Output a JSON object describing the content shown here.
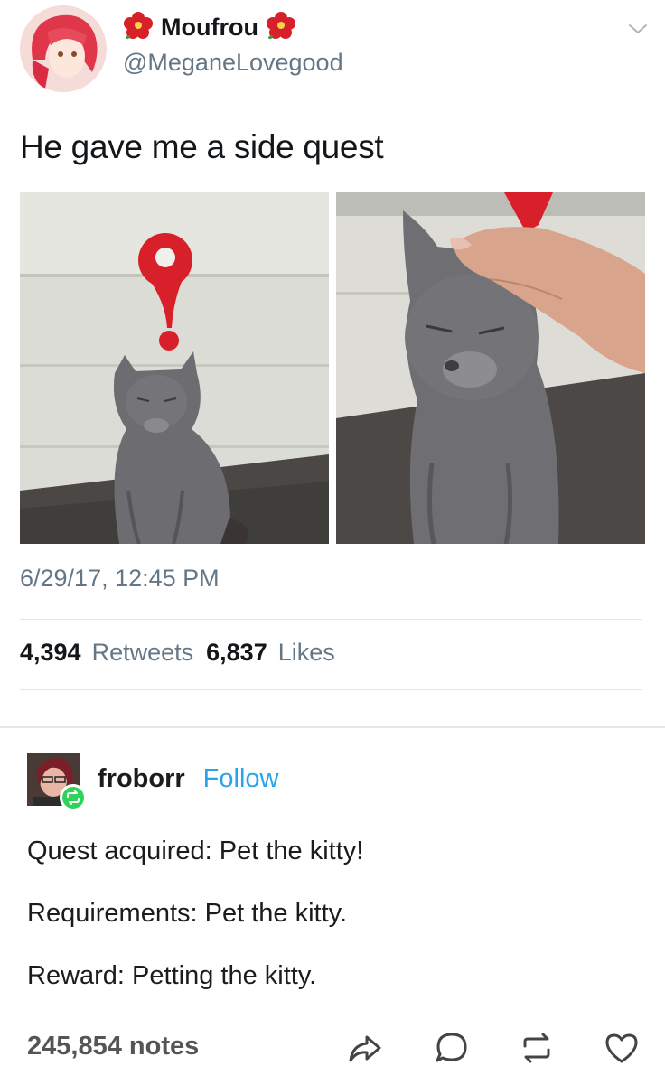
{
  "tweet": {
    "display_name": "Moufrou",
    "handle": "@MeganeLovegood",
    "text": "He gave me a side quest",
    "timestamp": "6/29/17, 12:45 PM",
    "retweets_count": "4,394",
    "retweets_label": "Retweets",
    "likes_count": "6,837",
    "likes_label": "Likes",
    "name_emoji_icon": "hibiscus-flower-icon",
    "menu_icon": "chevron-down-icon",
    "photos": [
      "photo of grey cat sitting under red exclamation mark",
      "photo of grey cat being petted"
    ]
  },
  "reblog": {
    "blog_name": "froborr",
    "follow_label": "Follow",
    "lines": [
      "Quest acquired: Pet the kitty!",
      "Requirements: Pet the kitty.",
      "Reward: Petting the kitty."
    ],
    "notes": "245,854 notes",
    "actions": [
      "share-icon",
      "reply-icon",
      "reblog-icon",
      "like-icon"
    ]
  },
  "colors": {
    "secondary_text": "#657786",
    "follow_blue": "#2aa3ef",
    "reblog_green": "#2fd35c",
    "quest_red": "#d8202a"
  }
}
